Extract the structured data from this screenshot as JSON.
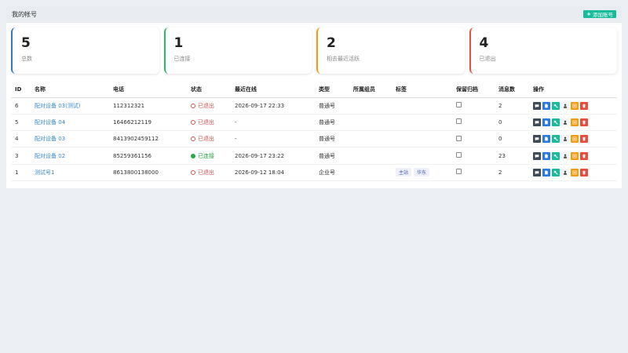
{
  "panel": {
    "title": "我的帐号",
    "add_button": "添加账号"
  },
  "stats": [
    {
      "value": "5",
      "label": "总数"
    },
    {
      "value": "1",
      "label": "已连接"
    },
    {
      "value": "2",
      "label": "相去最近活跃"
    },
    {
      "value": "4",
      "label": "已退出"
    }
  ],
  "table": {
    "headers": [
      "ID",
      "名称",
      "电话",
      "状态",
      "最近在线",
      "类型",
      "所属组员",
      "标签",
      "保留归档",
      "消息数",
      "操作"
    ],
    "rows": [
      {
        "id": "6",
        "name": "配对设备 03(测试)",
        "phone": "112312321",
        "status": "已退出",
        "last": "2026-09-17 22:33",
        "type": "普通号",
        "group": "",
        "tags": [],
        "count": "2"
      },
      {
        "id": "5",
        "name": "配对设备 04",
        "phone": "16466212119",
        "status": "已退出",
        "last": "-",
        "type": "普通号",
        "group": "",
        "tags": [],
        "count": "0"
      },
      {
        "id": "4",
        "name": "配对设备 03",
        "phone": "8413902459112",
        "status": "已退出",
        "last": "-",
        "type": "普通号",
        "group": "",
        "tags": [],
        "count": "0"
      },
      {
        "id": "3",
        "name": "配对设备 02",
        "phone": "85259361156",
        "status": "已连接",
        "last": "2026-09-17 23:22",
        "type": "普通号",
        "group": "",
        "tags": [],
        "count": "23"
      },
      {
        "id": "1",
        "name": "测试号1",
        "phone": "8613800138000",
        "status": "已退出",
        "last": "2026-09-12 18:04",
        "type": "企业号",
        "group": "",
        "tags": [
          "主站",
          "华东"
        ],
        "count": "2"
      }
    ]
  },
  "status_colors": {
    "online": "#28a745",
    "offline": "#d9534f"
  },
  "action_icons": [
    "chat-icon",
    "file-icon",
    "key-icon",
    "user-icon",
    "note-icon",
    "trash-icon"
  ]
}
